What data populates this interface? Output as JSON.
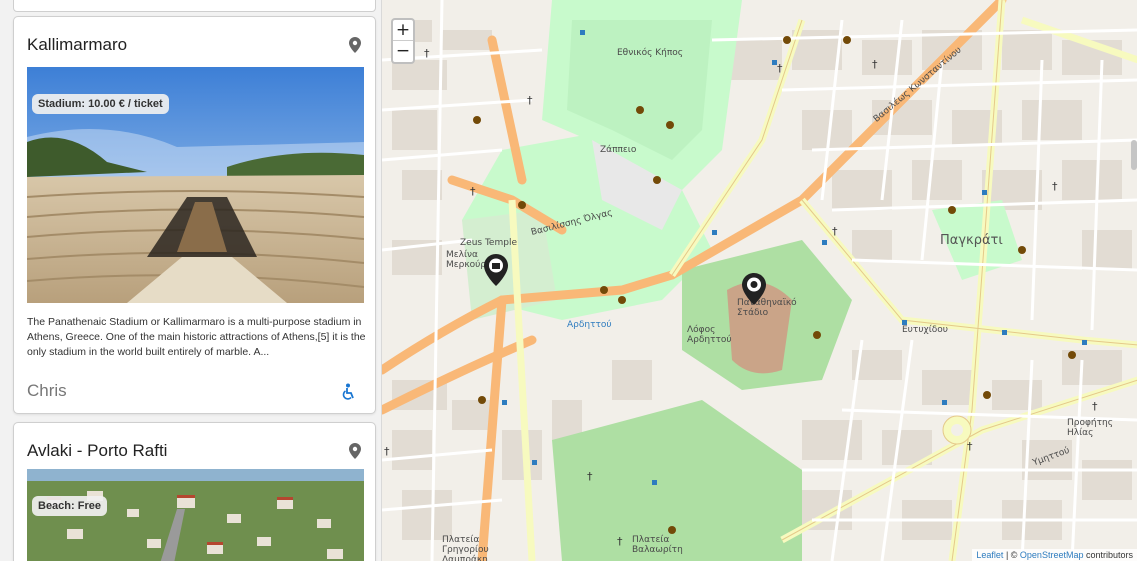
{
  "cards": [
    {
      "title": "Kallimarmaro",
      "price_badge": "Stadium: 10.00 € / ticket",
      "description": "The Panathenaic Stadium or Kallimarmaro is a multi-purpose stadium in Athens, Greece. One of the main historic attractions of Athens,[5] it is the only stadium in the world built entirely of marble. A...",
      "author": "Chris",
      "icons": [
        "location-pin-icon",
        "wheelchair-accessible-icon"
      ]
    },
    {
      "title": "Avlaki - Porto Rafti",
      "price_badge": "Beach: Free",
      "icons": [
        "location-pin-icon"
      ]
    }
  ],
  "map": {
    "zoom_in": "+",
    "zoom_out": "−",
    "attribution_leaflet": "Leaflet",
    "attribution_sep": " | © ",
    "attribution_osm": "OpenStreetMap",
    "attribution_tail": " contributors",
    "labels": {
      "pagkrati": "Παγκράτι",
      "zeus_temple": "Zeus Temple",
      "panathinaiko": "Παναθηναϊκό Στάδιο",
      "ardittos": "Λόφος Αρδηττού",
      "propylaia": "Προφήτης Ηλίας",
      "kipos": "Εθνικός Κήπος",
      "zappeio": "Ζάππειο",
      "melina": "Μελίνα Μερκούρη",
      "ardittou_st": "Αρδηττού",
      "vasilissis_olgas": "Βασιλίσσης Όλγας",
      "vas_konstantinou": "Βασιλέως Κωνσταντίνου",
      "ymittou": "Υμηττού",
      "eftichidou": "Ευτυχίδου",
      "ploutarchou": "Πλατεία Γρηγορίου Λαμπράκη",
      "platonos": "Πλατεία Βαλαωρίτη"
    },
    "colors": {
      "land": "#f2efe9",
      "park": "#c8facc",
      "park_dark": "#aedfa3",
      "road_orange": "#f9b877",
      "road_yellow": "#f7fabf",
      "building": "#d9d0c9",
      "poi": "#734a08",
      "water_blue": "#2e7cbf"
    }
  }
}
